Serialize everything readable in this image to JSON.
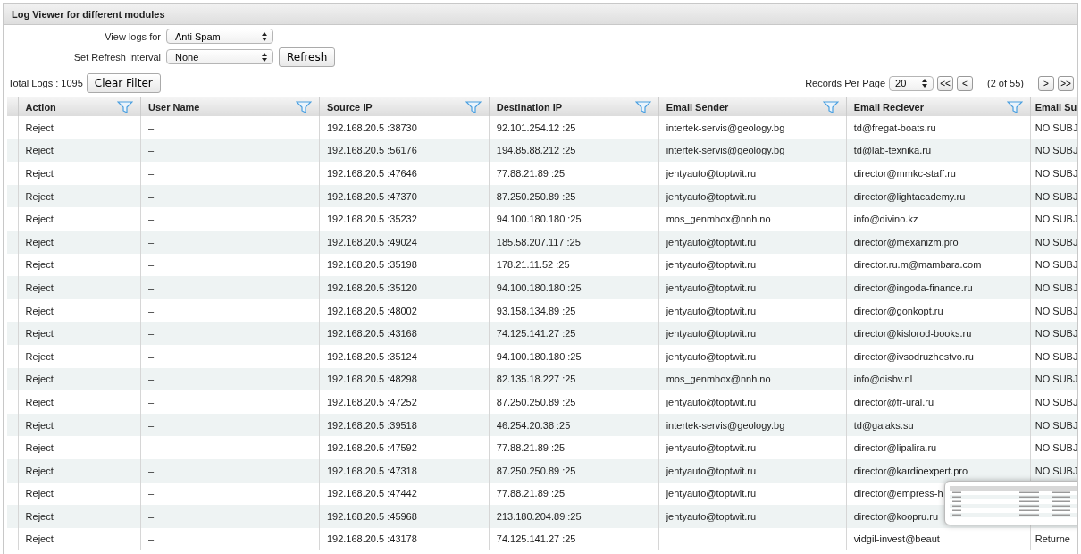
{
  "panel": {
    "title": "Log Viewer for different modules"
  },
  "controls": {
    "view_logs_label": "View logs for",
    "view_logs_value": "Anti Spam",
    "refresh_label": "Set Refresh Interval",
    "refresh_value": "None",
    "refresh_button": "Refresh"
  },
  "summary": {
    "total": "Total Logs : 1095",
    "clear_button": "Clear Filter"
  },
  "pager": {
    "label": "Records Per Page",
    "per_page": "20",
    "first": "<<",
    "prev": "<",
    "status": "(2 of 55)",
    "next": ">",
    "last": ">>"
  },
  "table": {
    "columns": [
      {
        "label": "Action",
        "filter": true
      },
      {
        "label": "User Name",
        "filter": true
      },
      {
        "label": "Source IP",
        "filter": true
      },
      {
        "label": "Destination IP",
        "filter": true
      },
      {
        "label": "Email Sender",
        "filter": true
      },
      {
        "label": "Email Reciever",
        "filter": true
      },
      {
        "label": "Email Su"
      }
    ],
    "rows": [
      [
        "Reject",
        "–",
        "192.168.20.5 :38730",
        "92.101.254.12 :25",
        "intertek-servis@geology.bg",
        "td@fregat-boats.ru",
        "NO SUBJ"
      ],
      [
        "Reject",
        "–",
        "192.168.20.5 :56176",
        "194.85.88.212 :25",
        "intertek-servis@geology.bg",
        "td@lab-texnika.ru",
        "NO SUBJ"
      ],
      [
        "Reject",
        "–",
        "192.168.20.5 :47646",
        "77.88.21.89 :25",
        "jentyauto@toptwit.ru",
        "director@mmkc-staff.ru",
        "NO SUBJ"
      ],
      [
        "Reject",
        "–",
        "192.168.20.5 :47370",
        "87.250.250.89 :25",
        "jentyauto@toptwit.ru",
        "director@lightacademy.ru",
        "NO SUBJ"
      ],
      [
        "Reject",
        "–",
        "192.168.20.5 :35232",
        "94.100.180.180 :25",
        "mos_genmbox@nnh.no",
        "info@divino.kz",
        "NO SUBJ"
      ],
      [
        "Reject",
        "–",
        "192.168.20.5 :49024",
        "185.58.207.117 :25",
        "jentyauto@toptwit.ru",
        "director@mexanizm.pro",
        "NO SUBJ"
      ],
      [
        "Reject",
        "–",
        "192.168.20.5 :35198",
        "178.21.11.52 :25",
        "jentyauto@toptwit.ru",
        "director.ru.m@mambara.com",
        "NO SUBJ"
      ],
      [
        "Reject",
        "–",
        "192.168.20.5 :35120",
        "94.100.180.180 :25",
        "jentyauto@toptwit.ru",
        "director@ingoda-finance.ru",
        "NO SUBJ"
      ],
      [
        "Reject",
        "–",
        "192.168.20.5 :48002",
        "93.158.134.89 :25",
        "jentyauto@toptwit.ru",
        "director@gonkopt.ru",
        "NO SUBJ"
      ],
      [
        "Reject",
        "–",
        "192.168.20.5 :43168",
        "74.125.141.27 :25",
        "jentyauto@toptwit.ru",
        "director@kislorod-books.ru",
        "NO SUBJ"
      ],
      [
        "Reject",
        "–",
        "192.168.20.5 :35124",
        "94.100.180.180 :25",
        "jentyauto@toptwit.ru",
        "director@ivsodruzhestvo.ru",
        "NO SUBJ"
      ],
      [
        "Reject",
        "–",
        "192.168.20.5 :48298",
        "82.135.18.227 :25",
        "mos_genmbox@nnh.no",
        "info@disbv.nl",
        "NO SUBJ"
      ],
      [
        "Reject",
        "–",
        "192.168.20.5 :47252",
        "87.250.250.89 :25",
        "jentyauto@toptwit.ru",
        "director@fr-ural.ru",
        "NO SUBJ"
      ],
      [
        "Reject",
        "–",
        "192.168.20.5 :39518",
        "46.254.20.38 :25",
        "intertek-servis@geology.bg",
        "td@galaks.su",
        "NO SUBJ"
      ],
      [
        "Reject",
        "–",
        "192.168.20.5 :47592",
        "77.88.21.89 :25",
        "jentyauto@toptwit.ru",
        "director@lipalira.ru",
        "NO SUBJ"
      ],
      [
        "Reject",
        "–",
        "192.168.20.5 :47318",
        "87.250.250.89 :25",
        "jentyauto@toptwit.ru",
        "director@kardioexpert.pro",
        "NO SUBJ"
      ],
      [
        "Reject",
        "–",
        "192.168.20.5 :47442",
        "77.88.21.89 :25",
        "jentyauto@toptwit.ru",
        "director@empress-h"
      ],
      [
        "Reject",
        "–",
        "192.168.20.5 :45968",
        "213.180.204.89 :25",
        "jentyauto@toptwit.ru",
        "director@koopru.ru"
      ],
      [
        "Reject",
        "–",
        "192.168.20.5 :43178",
        "74.125.141.27 :25",
        "",
        "vidgil-invest@beaut",
        "Returne"
      ]
    ]
  },
  "thumbnail": {
    "kind": "screenshot-preview"
  }
}
